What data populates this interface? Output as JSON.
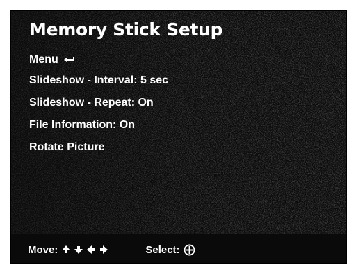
{
  "screen": {
    "title": "Memory Stick Setup",
    "menu_items": [
      {
        "label": "Menu",
        "icon": "return-arrow-icon"
      },
      {
        "label": "Slideshow - Interval: 5 sec"
      },
      {
        "label": "Slideshow - Repeat: On"
      },
      {
        "label": "File Information: On"
      },
      {
        "label": "Rotate Picture"
      }
    ]
  },
  "footer": {
    "move_label": "Move:",
    "move_icons": [
      "arrow-up-icon",
      "arrow-down-icon",
      "arrow-left-icon",
      "arrow-right-icon"
    ],
    "select_label": "Select:",
    "select_icon": "circle-plus-icon"
  },
  "colors": {
    "background": "#0a0a0a",
    "text": "#ffffff"
  }
}
